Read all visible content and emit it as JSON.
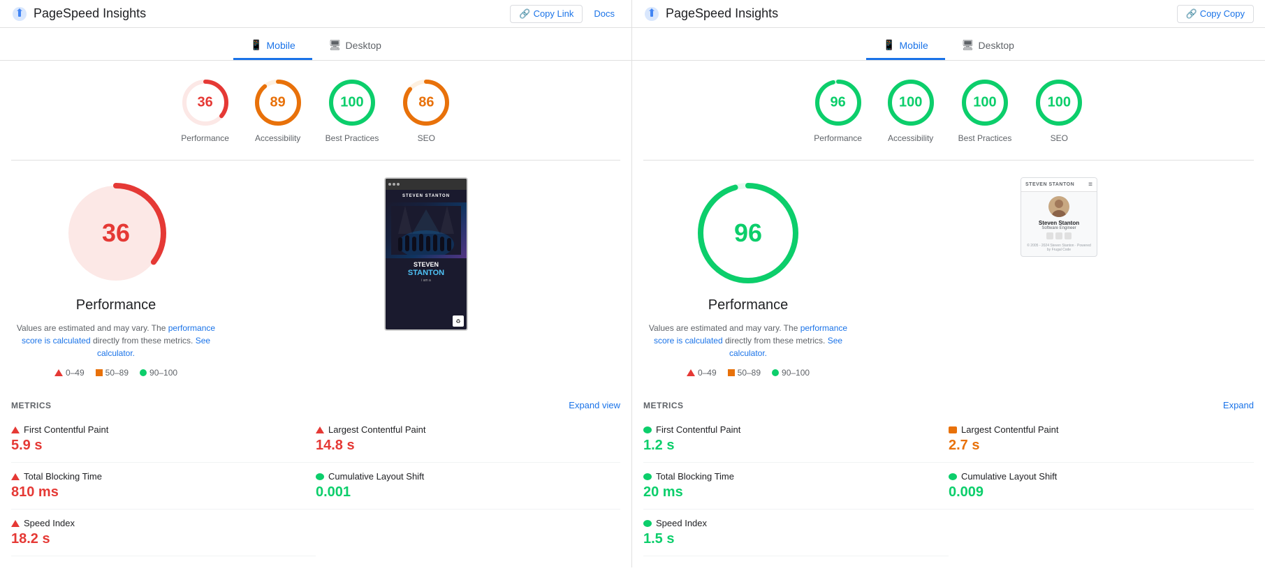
{
  "left": {
    "title": "PageSpeed Insights",
    "topActions": {
      "copyLink": "Copy Link",
      "docs": "Docs"
    },
    "tabs": [
      {
        "id": "mobile",
        "label": "Mobile",
        "active": true
      },
      {
        "id": "desktop",
        "label": "Desktop",
        "active": false
      }
    ],
    "scores": [
      {
        "id": "performance",
        "value": 36,
        "label": "Performance",
        "type": "red",
        "color": "#e53935",
        "trackColor": "#fce8e6",
        "range": 36
      },
      {
        "id": "accessibility",
        "value": 89,
        "label": "Accessibility",
        "type": "orange",
        "color": "#e8710a",
        "trackColor": "#fef0e0",
        "range": 89
      },
      {
        "id": "best-practices",
        "value": 100,
        "label": "Best Practices",
        "type": "green",
        "color": "#0cce6b",
        "trackColor": "#e6f9f0",
        "range": 100
      },
      {
        "id": "seo",
        "value": 86,
        "label": "SEO",
        "type": "orange",
        "color": "#e8710a",
        "trackColor": "#fef0e0",
        "range": 86
      }
    ],
    "bigScore": {
      "value": 36,
      "title": "Performance",
      "type": "red",
      "noteMain": "Values are estimated and may vary. The ",
      "noteLinkText": "performance score is calculated",
      "noteLink2": " directly from these metrics. ",
      "calcText": "See calculator.",
      "legend": [
        {
          "type": "triangle",
          "color": "#e53935",
          "label": "0–49"
        },
        {
          "type": "square",
          "color": "#e8710a",
          "label": "50–89"
        },
        {
          "type": "dot",
          "color": "#0cce6b",
          "label": "90–100"
        }
      ]
    },
    "metrics": {
      "title": "METRICS",
      "expandLabel": "Expand view",
      "items": [
        {
          "name": "First Contentful Paint",
          "value": "5.9 s",
          "type": "red",
          "indicator": "triangle"
        },
        {
          "name": "Largest Contentful Paint",
          "value": "14.8 s",
          "type": "red",
          "indicator": "triangle"
        },
        {
          "name": "Total Blocking Time",
          "value": "810 ms",
          "type": "red",
          "indicator": "triangle"
        },
        {
          "name": "Cumulative Layout Shift",
          "value": "0.001",
          "type": "green",
          "indicator": "dot"
        },
        {
          "name": "Speed Index",
          "value": "18.2 s",
          "type": "red",
          "indicator": "triangle"
        }
      ]
    }
  },
  "right": {
    "title": "PageSpeed Insights",
    "topActions": {
      "copyLink": "Copy Copy"
    },
    "tabs": [
      {
        "id": "mobile",
        "label": "Mobile",
        "active": true
      },
      {
        "id": "desktop",
        "label": "Desktop",
        "active": false
      }
    ],
    "scores": [
      {
        "id": "performance",
        "value": 96,
        "label": "Performance",
        "type": "green",
        "color": "#0cce6b",
        "trackColor": "#e6f9f0"
      },
      {
        "id": "accessibility",
        "value": 100,
        "label": "Accessibility",
        "type": "green",
        "color": "#0cce6b",
        "trackColor": "#e6f9f0"
      },
      {
        "id": "best-practices",
        "value": 100,
        "label": "Best Practices",
        "type": "green",
        "color": "#0cce6b",
        "trackColor": "#e6f9f0"
      },
      {
        "id": "seo",
        "value": 100,
        "label": "SEO",
        "type": "green",
        "color": "#0cce6b",
        "trackColor": "#e6f9f0"
      }
    ],
    "bigScore": {
      "value": 96,
      "title": "Performance",
      "type": "green",
      "noteMain": "Values are estimated and may vary. The ",
      "noteLinkText": "performance score is calculated",
      "noteLink2": " directly from these metrics. ",
      "calcText": "See calculator.",
      "legend": [
        {
          "type": "triangle",
          "color": "#e53935",
          "label": "0–49"
        },
        {
          "type": "square",
          "color": "#e8710a",
          "label": "50–89"
        },
        {
          "type": "dot",
          "color": "#0cce6b",
          "label": "90–100"
        }
      ]
    },
    "preview": {
      "topbarTitle": "STEVEN STANTON",
      "personName": "Steven Stanton",
      "personTitle": "Software Engineer",
      "footer": "© 2005 - 2024 Steven Stanton · Powered by Frugal Code"
    },
    "metrics": {
      "title": "METRICS",
      "expandLabel": "Expand",
      "items": [
        {
          "name": "First Contentful Paint",
          "value": "1.2 s",
          "type": "green",
          "indicator": "dot"
        },
        {
          "name": "Largest Contentful Paint",
          "value": "2.7 s",
          "type": "orange",
          "indicator": "square"
        },
        {
          "name": "Total Blocking Time",
          "value": "20 ms",
          "type": "green",
          "indicator": "dot"
        },
        {
          "name": "Cumulative Layout Shift",
          "value": "0.009",
          "type": "green",
          "indicator": "dot"
        },
        {
          "name": "Speed Index",
          "value": "1.5 s",
          "type": "green",
          "indicator": "dot"
        }
      ]
    }
  }
}
